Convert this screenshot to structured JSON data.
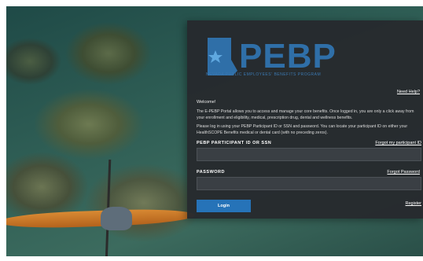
{
  "brand": {
    "logo_text": "PEBP",
    "logo_subtitle": "NEVADA PUBLIC EMPLOYEES' BENEFITS PROGRAM",
    "logo_color": "#2f6fa8"
  },
  "links": {
    "need_help": "Need Help?",
    "forgot_id": "Forgot my participant ID",
    "forgot_password": "Forgot Password",
    "register": "Register"
  },
  "intro": {
    "welcome": "Welcome!",
    "paragraph1": "The E-PEBP Portal allows you to access and manage your core benefits. Once logged in, you are only a click away from your enrollment and eligibility, medical, prescription drug, dental and wellness benefits.",
    "paragraph2": "Please log in using your PEBP Participant ID or SSN and password. You can locate your participant ID on either your HealthSCOPE Benefits medical or dental card (with no preceding zeros)."
  },
  "form": {
    "id_label": "PEBP PARTICIPANT ID OR SSN",
    "id_value": "",
    "password_label": "PASSWORD",
    "password_value": "",
    "login_label": "Login"
  },
  "icons": {
    "logo": "nevada-star-icon"
  },
  "colors": {
    "panel_bg": "#262a2e",
    "button": "#2673b8"
  }
}
